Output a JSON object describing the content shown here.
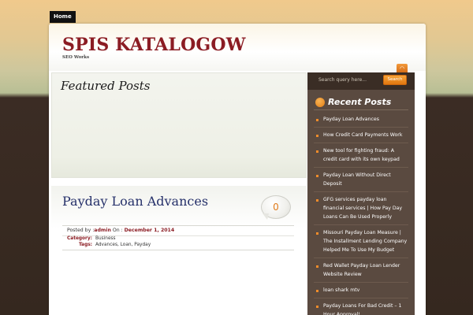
{
  "nav": {
    "home_label": "Home"
  },
  "header": {
    "site_title": "SPIS KATALOGOW",
    "site_description": "SEO Works"
  },
  "featured": {
    "title": "Featured Posts"
  },
  "post": {
    "title": "Payday Loan Advances",
    "comment_count": "0",
    "posted_by_label": "Posted by :",
    "author": "admin",
    "on_label": " On : ",
    "date": "December 1, 2014",
    "category_label": "Category:",
    "category": "Business",
    "tags_label": "Tags:",
    "tags": [
      "Advances",
      "Loan",
      "Payday"
    ]
  },
  "sidebar": {
    "search_placeholder": "Search query here...",
    "search_button": "Search",
    "recent_title": "Recent Posts",
    "recent_posts": [
      "Payday Loan Advances",
      "How Credit Card Payments Work",
      "New tool for fighting fraud: A credit card with its own keypad",
      "Payday Loan Without Direct Deposit",
      "GFG services payday loan financial services | How Pay Day Loans Can Be Used Properly",
      "Missouri Payday Loan Measure | The Installment Lending Company Helped Me To Use My Budget",
      "Red Wallet Payday Loan Lender Website Review",
      "loan shark mtv",
      "Payday Loans For Bad Credit – 1 Hour Approval!"
    ]
  },
  "icons": {
    "rss": "rss-icon",
    "bullet": "square-bullet-icon",
    "recent_marker": "orange-circle-icon"
  },
  "colors": {
    "title_red": "#8b1c23",
    "post_title_blue": "#25306a",
    "accent_orange": "#e27d14",
    "sidebar_brown": "#5a4a40"
  }
}
